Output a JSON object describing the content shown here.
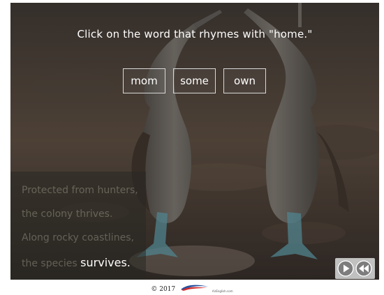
{
  "activity": {
    "prompt": "Click on the word that rhymes with \"home.\"",
    "choices": [
      {
        "label": "mom"
      },
      {
        "label": "some"
      },
      {
        "label": "own"
      }
    ]
  },
  "poem": {
    "line1": "Protected from hunters,",
    "line2": "the colony thrives.",
    "line3": "Along rocky coastlines,",
    "line4_prefix": "the species",
    "line4_highlight": "survives."
  },
  "controls": {
    "play_icon": "play-icon",
    "rewind_icon": "rewind-icon"
  },
  "footer": {
    "copyright": "© 2017",
    "brand": "AirEnglish.com"
  },
  "colors": {
    "text": "#ffffff",
    "choice_border": "#d8d8d8",
    "poem_dim_text": "#c8c8b4"
  }
}
